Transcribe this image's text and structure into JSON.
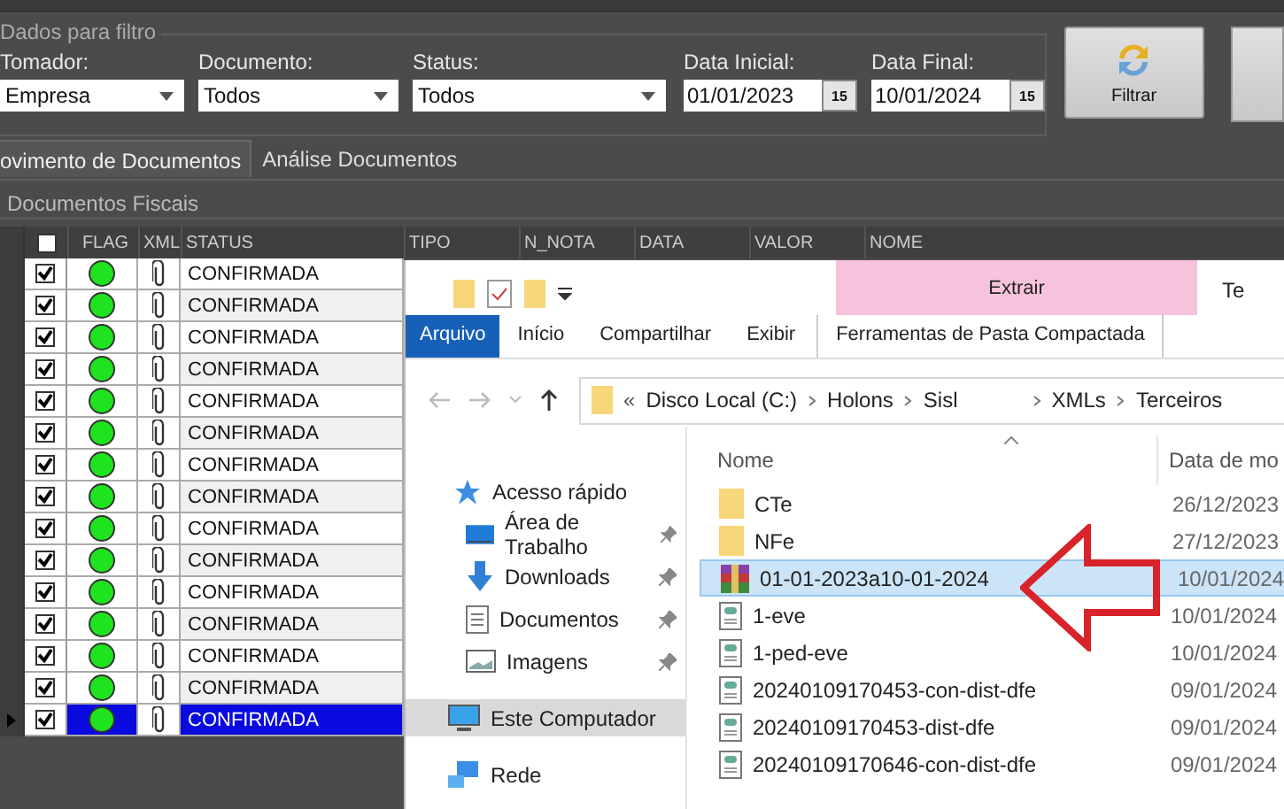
{
  "filter": {
    "title": "Dados para filtro",
    "fields": [
      {
        "kind": "select",
        "label": "Tomador:",
        "value": "Empresa"
      },
      {
        "kind": "select",
        "label": "Documento:",
        "value": "Todos"
      },
      {
        "kind": "select",
        "label": "Status:",
        "value": "Todos"
      },
      {
        "kind": "date",
        "label": "Data Inicial:",
        "value": "01/01/2023",
        "button": "15"
      },
      {
        "kind": "date",
        "label": "Data Final:",
        "value": "10/01/2024",
        "button": "15"
      }
    ],
    "button": "Filtrar"
  },
  "tabs": [
    {
      "label": "ovimento de Documentos",
      "selected": true
    },
    {
      "label": "Análise Documentos",
      "selected": false
    }
  ],
  "panel_title": "Documentos Fiscais",
  "grid": {
    "header_checked": false,
    "columns": [
      "FLAG",
      "XML",
      "STATUS",
      "TIPO",
      "N_NOTA",
      "DATA",
      "VALOR",
      "NOME"
    ],
    "rows": [
      {
        "checked": true,
        "color": "#1ee31e",
        "status": "CONFIRMADA",
        "selected": false
      },
      {
        "checked": true,
        "color": "#1ee31e",
        "status": "CONFIRMADA",
        "selected": false
      },
      {
        "checked": true,
        "color": "#1ee31e",
        "status": "CONFIRMADA",
        "selected": false
      },
      {
        "checked": true,
        "color": "#1ee31e",
        "status": "CONFIRMADA",
        "selected": false
      },
      {
        "checked": true,
        "color": "#1ee31e",
        "status": "CONFIRMADA",
        "selected": false
      },
      {
        "checked": true,
        "color": "#1ee31e",
        "status": "CONFIRMADA",
        "selected": false
      },
      {
        "checked": true,
        "color": "#1ee31e",
        "status": "CONFIRMADA",
        "selected": false
      },
      {
        "checked": true,
        "color": "#1ee31e",
        "status": "CONFIRMADA",
        "selected": false
      },
      {
        "checked": true,
        "color": "#1ee31e",
        "status": "CONFIRMADA",
        "selected": false
      },
      {
        "checked": true,
        "color": "#1ee31e",
        "status": "CONFIRMADA",
        "selected": false
      },
      {
        "checked": true,
        "color": "#1ee31e",
        "status": "CONFIRMADA",
        "selected": false
      },
      {
        "checked": true,
        "color": "#1ee31e",
        "status": "CONFIRMADA",
        "selected": false
      },
      {
        "checked": true,
        "color": "#1ee31e",
        "status": "CONFIRMADA",
        "selected": false
      },
      {
        "checked": true,
        "color": "#1ee31e",
        "status": "CONFIRMADA",
        "selected": false
      },
      {
        "checked": true,
        "color": "#1ee31e",
        "status": "CONFIRMADA",
        "selected": true
      }
    ]
  },
  "explorer": {
    "title": "Te",
    "context_tab": "Extrair",
    "ribbon_tabs": [
      {
        "label": "Arquivo",
        "selected": true
      },
      {
        "label": "Início",
        "selected": false
      },
      {
        "label": "Compartilhar",
        "selected": false
      },
      {
        "label": "Exibir",
        "selected": false
      },
      {
        "label": "Ferramentas de Pasta Compactada",
        "selected": false
      }
    ],
    "path_prefix": "«",
    "path": [
      "Disco Local (C:)",
      "Holons",
      "Sisl",
      "XMLs",
      "Terceiros"
    ],
    "nav": [
      {
        "kind": "star",
        "label": "Acesso rápido",
        "pinned": false,
        "selected": false
      },
      {
        "kind": "desktop",
        "label": "Área de Trabalho",
        "pinned": true,
        "selected": false
      },
      {
        "kind": "download",
        "label": "Downloads",
        "pinned": true,
        "selected": false
      },
      {
        "kind": "document",
        "label": "Documentos",
        "pinned": true,
        "selected": false
      },
      {
        "kind": "image",
        "label": "Imagens",
        "pinned": true,
        "selected": false
      },
      {
        "kind": "computer",
        "label": "Este Computador",
        "pinned": false,
        "selected": true
      },
      {
        "kind": "network",
        "label": "Rede",
        "pinned": false,
        "selected": false
      }
    ],
    "columns": [
      "Nome",
      "Data de mo"
    ],
    "files": [
      {
        "kind": "folder",
        "name": "CTe",
        "date": "26/12/2023",
        "selected": false
      },
      {
        "kind": "folder",
        "name": "NFe",
        "date": "27/12/2023",
        "selected": false
      },
      {
        "kind": "archive",
        "name": "01-01-2023a10-01-2024",
        "date": "10/01/2024",
        "selected": true
      },
      {
        "kind": "xml",
        "name": "1-eve",
        "date": "10/01/2024",
        "selected": false
      },
      {
        "kind": "xml",
        "name": "1-ped-eve",
        "date": "10/01/2024",
        "selected": false
      },
      {
        "kind": "xml",
        "name": "20240109170453-con-dist-dfe",
        "date": "09/01/2024",
        "selected": false
      },
      {
        "kind": "xml",
        "name": "20240109170453-dist-dfe",
        "date": "09/01/2024",
        "selected": false
      },
      {
        "kind": "xml",
        "name": "20240109170646-con-dist-dfe",
        "date": "09/01/2024",
        "selected": false
      }
    ]
  }
}
